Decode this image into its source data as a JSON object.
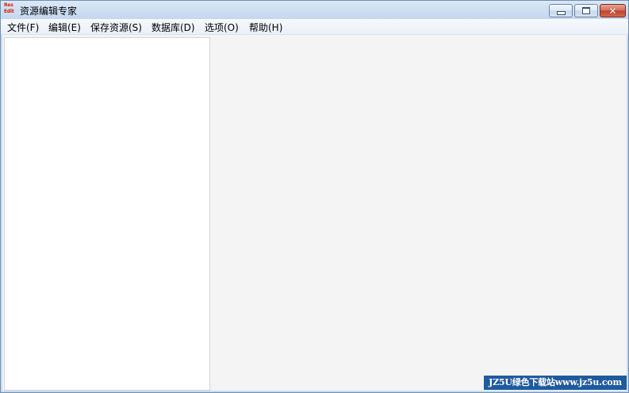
{
  "window": {
    "title": "资源编辑专家",
    "app_icon_lines": [
      "Res",
      "Edit"
    ],
    "caption_buttons": {
      "minimize": "minimize-icon",
      "maximize": "maximize-icon",
      "close": "close-icon",
      "close_glyph": "✕"
    }
  },
  "menubar": {
    "items": [
      {
        "label": "文件(F)"
      },
      {
        "label": "编辑(E)"
      },
      {
        "label": "保存资源(S)"
      },
      {
        "label": "数据库(D)"
      },
      {
        "label": "选项(O)"
      },
      {
        "label": "帮助(H)"
      }
    ]
  },
  "watermark": {
    "text": "JZ5U绿色下载站www.jz5u.com"
  },
  "colors": {
    "title_gradient_top": "#dbe8f6",
    "close_button": "#c1452c",
    "client_background": "#f4f4f4",
    "watermark_background": "#1f5a9e"
  }
}
